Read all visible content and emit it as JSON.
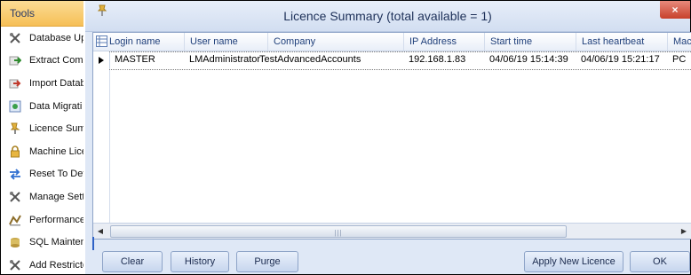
{
  "tools": {
    "header": "Tools",
    "items": [
      {
        "label": "Database Up",
        "icon": "crossed-tools-icon"
      },
      {
        "label": "Extract Comp",
        "icon": "extract-arrow-icon"
      },
      {
        "label": "Import Datab",
        "icon": "import-arrow-icon"
      },
      {
        "label": "Data Migrati",
        "icon": "data-migration-icon"
      },
      {
        "label": "Licence Summ",
        "icon": "pin-icon"
      },
      {
        "label": "Machine Lice",
        "icon": "padlock-icon"
      },
      {
        "label": "Reset To Def",
        "icon": "reset-arrows-icon"
      },
      {
        "label": "Manage Sett",
        "icon": "crossed-tools-icon"
      },
      {
        "label": "Performance",
        "icon": "performance-icon"
      },
      {
        "label": "SQL Mainten",
        "icon": "sql-maintenance-icon"
      },
      {
        "label": "Add Restricte",
        "icon": "crossed-tools-icon"
      }
    ]
  },
  "dialog": {
    "title": "Licence Summary (total available = 1)",
    "close_label": "×",
    "columns": [
      "Login name",
      "User name",
      "Company",
      "IP Address",
      "Start time",
      "Last heartbeat",
      "Mac"
    ],
    "rows": [
      {
        "login_name": "MASTER",
        "user_name": "LMAdministrator",
        "company": "TestAdvancedAccounts",
        "ip_address": "192.168.1.83",
        "start_time": "04/06/19 15:14:39",
        "last_heartbeat": "04/06/19 15:21:17",
        "machine": "PC"
      }
    ],
    "buttons": {
      "clear": "Clear",
      "history": "History",
      "purge": "Purge",
      "apply_new_licence": "Apply New Licence",
      "ok": "OK"
    }
  },
  "colors": {
    "tools_header": "#f6bf56",
    "dialog_bg": "#dfe8f6",
    "close_button": "#c7402b",
    "header_text": "#1f3f7a"
  }
}
